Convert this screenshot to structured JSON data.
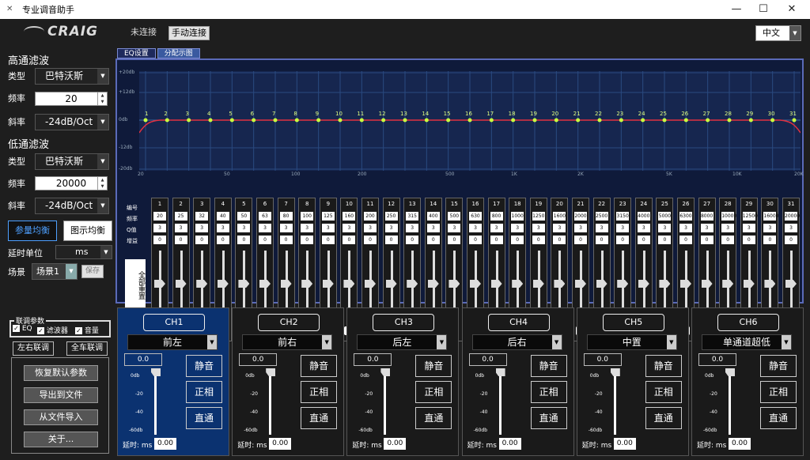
{
  "window": {
    "title": "专业调音助手"
  },
  "header": {
    "logo": "CRAIG",
    "status": "未连接",
    "connect": "手动连接",
    "language": "中文"
  },
  "highpass": {
    "title": "高通滤波",
    "type_label": "类型",
    "type": "巴特沃斯",
    "freq_label": "频率",
    "freq": "20",
    "slope_label": "斜率",
    "slope": "-24dB/Oct"
  },
  "lowpass": {
    "title": "低通滤波",
    "type_label": "类型",
    "type": "巴特沃斯",
    "freq_label": "频率",
    "freq": "20000",
    "slope_label": "斜率",
    "slope": "-24dB/Oct"
  },
  "modes": {
    "param": "参量均衡",
    "graphic": "图示均衡"
  },
  "delay_unit": {
    "label": "延时单位",
    "value": "ms"
  },
  "scene": {
    "label": "场景",
    "value": "场景1",
    "save": "保存"
  },
  "link": {
    "title": "联调参数",
    "eq": "EQ",
    "filter": "滤波器",
    "volume": "音量",
    "lr": "左右联调",
    "all": "全车联调"
  },
  "actions": {
    "restore": "恢复默认参数",
    "export": "导出到文件",
    "import": "从文件导入",
    "about": "关于..."
  },
  "tabs": [
    "EQ设置",
    "分配示图"
  ],
  "graph": {
    "y_labels": [
      "+20db",
      "+12db",
      "0db",
      "-12db",
      "-20db"
    ],
    "x_labels": [
      "20",
      "50",
      "100",
      "200",
      "500",
      "1K",
      "2K",
      "5K",
      "10K",
      "20K"
    ]
  },
  "eq": {
    "row_labels": [
      "编号",
      "频率",
      "Q值",
      "增益"
    ],
    "reset": "全部重置",
    "bands": [
      {
        "n": "1",
        "f": "20"
      },
      {
        "n": "2",
        "f": "25"
      },
      {
        "n": "3",
        "f": "32"
      },
      {
        "n": "4",
        "f": "40"
      },
      {
        "n": "5",
        "f": "50"
      },
      {
        "n": "6",
        "f": "63"
      },
      {
        "n": "7",
        "f": "80"
      },
      {
        "n": "8",
        "f": "100"
      },
      {
        "n": "9",
        "f": "125"
      },
      {
        "n": "10",
        "f": "160"
      },
      {
        "n": "11",
        "f": "200"
      },
      {
        "n": "12",
        "f": "250"
      },
      {
        "n": "13",
        "f": "315"
      },
      {
        "n": "14",
        "f": "400"
      },
      {
        "n": "15",
        "f": "500"
      },
      {
        "n": "16",
        "f": "630"
      },
      {
        "n": "17",
        "f": "800"
      },
      {
        "n": "18",
        "f": "1000"
      },
      {
        "n": "19",
        "f": "1250"
      },
      {
        "n": "20",
        "f": "1600"
      },
      {
        "n": "21",
        "f": "2000"
      },
      {
        "n": "22",
        "f": "2500"
      },
      {
        "n": "23",
        "f": "3150"
      },
      {
        "n": "24",
        "f": "4000"
      },
      {
        "n": "25",
        "f": "5000"
      },
      {
        "n": "26",
        "f": "6300"
      },
      {
        "n": "27",
        "f": "8000"
      },
      {
        "n": "28",
        "f": "10000"
      },
      {
        "n": "29",
        "f": "12500"
      },
      {
        "n": "30",
        "f": "16000"
      },
      {
        "n": "31",
        "f": "20000"
      }
    ],
    "q": "3",
    "gain": "0"
  },
  "channels": [
    {
      "name": "CH1",
      "assign": "前左",
      "gain": "0.0",
      "delay": "0.00"
    },
    {
      "name": "CH2",
      "assign": "前右",
      "gain": "0.0",
      "delay": "0.00"
    },
    {
      "name": "CH3",
      "assign": "后左",
      "gain": "0.0",
      "delay": "0.00"
    },
    {
      "name": "CH4",
      "assign": "后右",
      "gain": "0.0",
      "delay": "0.00"
    },
    {
      "name": "CH5",
      "assign": "中置",
      "gain": "0.0",
      "delay": "0.00"
    },
    {
      "name": "CH6",
      "assign": "单通道超低",
      "gain": "0.0",
      "delay": "0.00"
    }
  ],
  "channel_ui": {
    "mute": "静音",
    "phase": "正相",
    "bypass": "直通",
    "delay_label": "延时: ms",
    "scale": [
      "0db",
      "-20",
      "-40",
      "-60db"
    ]
  }
}
